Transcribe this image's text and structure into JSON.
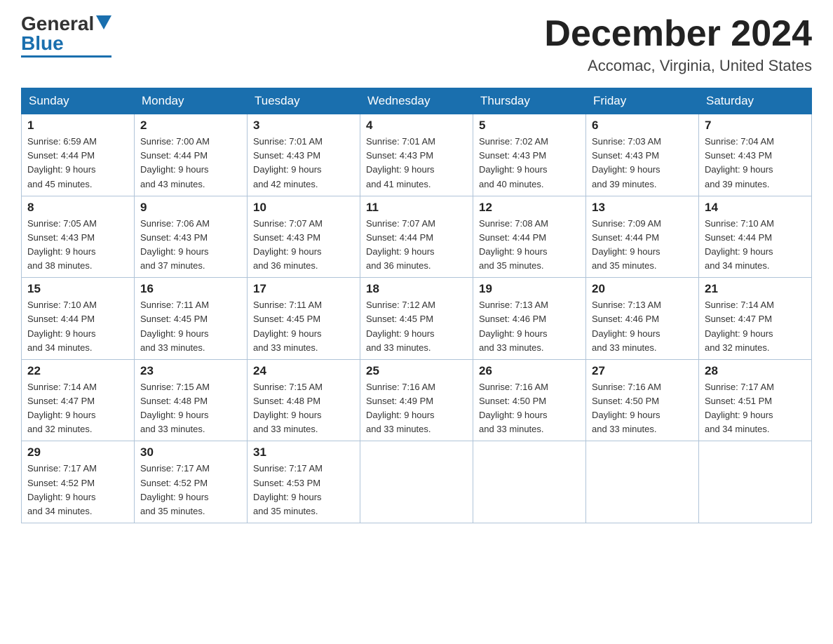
{
  "header": {
    "logo_general": "General",
    "logo_blue": "Blue",
    "month_title": "December 2024",
    "location": "Accomac, Virginia, United States"
  },
  "days_of_week": [
    "Sunday",
    "Monday",
    "Tuesday",
    "Wednesday",
    "Thursday",
    "Friday",
    "Saturday"
  ],
  "weeks": [
    [
      {
        "day": "1",
        "sunrise": "6:59 AM",
        "sunset": "4:44 PM",
        "daylight": "9 hours and 45 minutes."
      },
      {
        "day": "2",
        "sunrise": "7:00 AM",
        "sunset": "4:44 PM",
        "daylight": "9 hours and 43 minutes."
      },
      {
        "day": "3",
        "sunrise": "7:01 AM",
        "sunset": "4:43 PM",
        "daylight": "9 hours and 42 minutes."
      },
      {
        "day": "4",
        "sunrise": "7:01 AM",
        "sunset": "4:43 PM",
        "daylight": "9 hours and 41 minutes."
      },
      {
        "day": "5",
        "sunrise": "7:02 AM",
        "sunset": "4:43 PM",
        "daylight": "9 hours and 40 minutes."
      },
      {
        "day": "6",
        "sunrise": "7:03 AM",
        "sunset": "4:43 PM",
        "daylight": "9 hours and 39 minutes."
      },
      {
        "day": "7",
        "sunrise": "7:04 AM",
        "sunset": "4:43 PM",
        "daylight": "9 hours and 39 minutes."
      }
    ],
    [
      {
        "day": "8",
        "sunrise": "7:05 AM",
        "sunset": "4:43 PM",
        "daylight": "9 hours and 38 minutes."
      },
      {
        "day": "9",
        "sunrise": "7:06 AM",
        "sunset": "4:43 PM",
        "daylight": "9 hours and 37 minutes."
      },
      {
        "day": "10",
        "sunrise": "7:07 AM",
        "sunset": "4:43 PM",
        "daylight": "9 hours and 36 minutes."
      },
      {
        "day": "11",
        "sunrise": "7:07 AM",
        "sunset": "4:44 PM",
        "daylight": "9 hours and 36 minutes."
      },
      {
        "day": "12",
        "sunrise": "7:08 AM",
        "sunset": "4:44 PM",
        "daylight": "9 hours and 35 minutes."
      },
      {
        "day": "13",
        "sunrise": "7:09 AM",
        "sunset": "4:44 PM",
        "daylight": "9 hours and 35 minutes."
      },
      {
        "day": "14",
        "sunrise": "7:10 AM",
        "sunset": "4:44 PM",
        "daylight": "9 hours and 34 minutes."
      }
    ],
    [
      {
        "day": "15",
        "sunrise": "7:10 AM",
        "sunset": "4:44 PM",
        "daylight": "9 hours and 34 minutes."
      },
      {
        "day": "16",
        "sunrise": "7:11 AM",
        "sunset": "4:45 PM",
        "daylight": "9 hours and 33 minutes."
      },
      {
        "day": "17",
        "sunrise": "7:11 AM",
        "sunset": "4:45 PM",
        "daylight": "9 hours and 33 minutes."
      },
      {
        "day": "18",
        "sunrise": "7:12 AM",
        "sunset": "4:45 PM",
        "daylight": "9 hours and 33 minutes."
      },
      {
        "day": "19",
        "sunrise": "7:13 AM",
        "sunset": "4:46 PM",
        "daylight": "9 hours and 33 minutes."
      },
      {
        "day": "20",
        "sunrise": "7:13 AM",
        "sunset": "4:46 PM",
        "daylight": "9 hours and 33 minutes."
      },
      {
        "day": "21",
        "sunrise": "7:14 AM",
        "sunset": "4:47 PM",
        "daylight": "9 hours and 32 minutes."
      }
    ],
    [
      {
        "day": "22",
        "sunrise": "7:14 AM",
        "sunset": "4:47 PM",
        "daylight": "9 hours and 32 minutes."
      },
      {
        "day": "23",
        "sunrise": "7:15 AM",
        "sunset": "4:48 PM",
        "daylight": "9 hours and 33 minutes."
      },
      {
        "day": "24",
        "sunrise": "7:15 AM",
        "sunset": "4:48 PM",
        "daylight": "9 hours and 33 minutes."
      },
      {
        "day": "25",
        "sunrise": "7:16 AM",
        "sunset": "4:49 PM",
        "daylight": "9 hours and 33 minutes."
      },
      {
        "day": "26",
        "sunrise": "7:16 AM",
        "sunset": "4:50 PM",
        "daylight": "9 hours and 33 minutes."
      },
      {
        "day": "27",
        "sunrise": "7:16 AM",
        "sunset": "4:50 PM",
        "daylight": "9 hours and 33 minutes."
      },
      {
        "day": "28",
        "sunrise": "7:17 AM",
        "sunset": "4:51 PM",
        "daylight": "9 hours and 34 minutes."
      }
    ],
    [
      {
        "day": "29",
        "sunrise": "7:17 AM",
        "sunset": "4:52 PM",
        "daylight": "9 hours and 34 minutes."
      },
      {
        "day": "30",
        "sunrise": "7:17 AM",
        "sunset": "4:52 PM",
        "daylight": "9 hours and 35 minutes."
      },
      {
        "day": "31",
        "sunrise": "7:17 AM",
        "sunset": "4:53 PM",
        "daylight": "9 hours and 35 minutes."
      },
      null,
      null,
      null,
      null
    ]
  ],
  "labels": {
    "sunrise": "Sunrise: ",
    "sunset": "Sunset: ",
    "daylight": "Daylight: "
  }
}
